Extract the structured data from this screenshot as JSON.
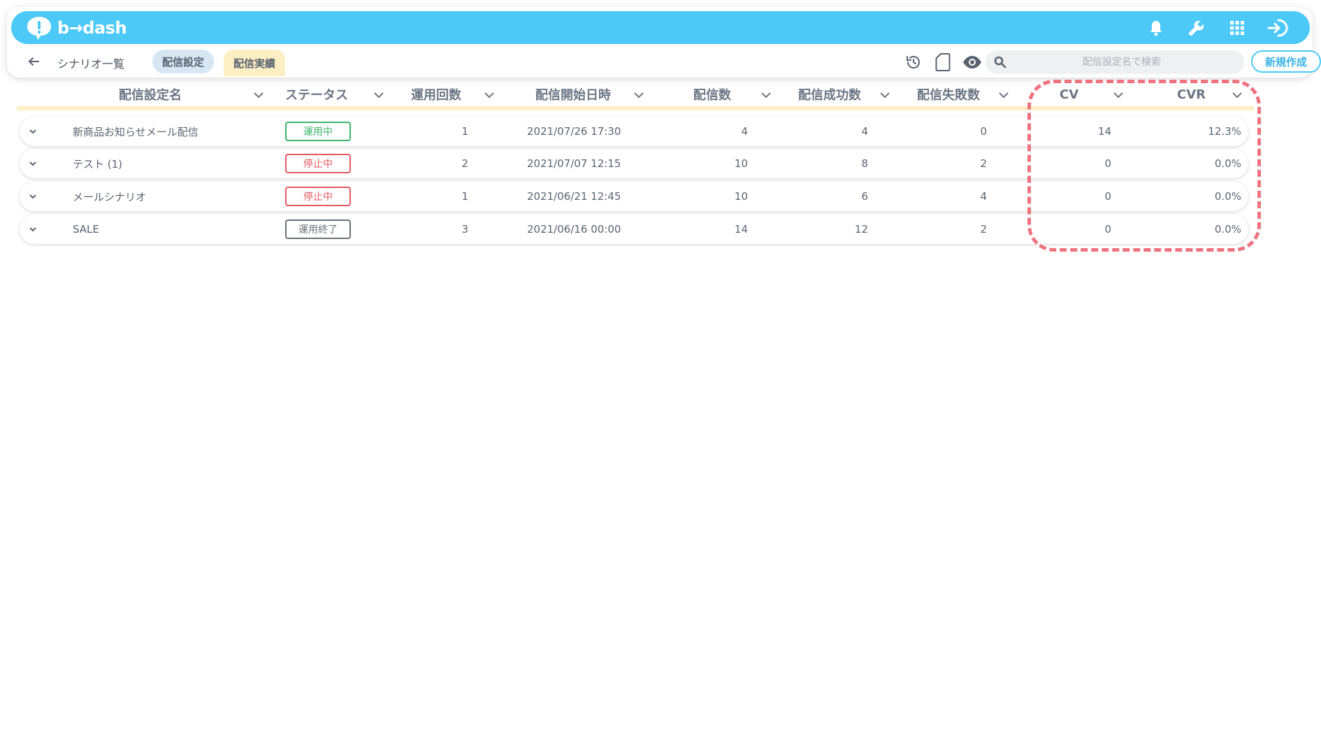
{
  "app": {
    "logo_text": "b→dash"
  },
  "colors": {
    "brand": "#4cc9f7",
    "active_green": "#3bb56b",
    "stopped_red": "#e5585f",
    "ended_gray": "#6a7077",
    "tab_yellow": "#fdefc4",
    "highlight": "#ef7280"
  },
  "topbar": {
    "icons": [
      "bell-icon",
      "wrench-icon",
      "grid-icon",
      "logout-icon"
    ]
  },
  "subnav": {
    "breadcrumb": "シナリオ一覧",
    "tabs": [
      {
        "label": "配信設定"
      },
      {
        "label": "配信実績"
      }
    ],
    "search_placeholder": "配信設定名で検索",
    "new_button": "新規作成"
  },
  "table": {
    "columns": [
      "配信設定名",
      "ステータス",
      "運用回数",
      "配信開始日時",
      "配信数",
      "配信成功数",
      "配信失敗数",
      "CV",
      "CVR"
    ],
    "rows": [
      {
        "name": "新商品お知らせメール配信",
        "status": "運用中",
        "status_kind": "active",
        "runs": "1",
        "start": "2021/07/26 17:30",
        "sent": "4",
        "success": "4",
        "failed": "0",
        "cv": "14",
        "cvr": "12.3%"
      },
      {
        "name": "テスト (1)",
        "status": "停止中",
        "status_kind": "stopped",
        "runs": "2",
        "start": "2021/07/07 12:15",
        "sent": "10",
        "success": "8",
        "failed": "2",
        "cv": "0",
        "cvr": "0.0%"
      },
      {
        "name": "メールシナリオ",
        "status": "停止中",
        "status_kind": "stopped",
        "runs": "1",
        "start": "2021/06/21 12:45",
        "sent": "10",
        "success": "6",
        "failed": "4",
        "cv": "0",
        "cvr": "0.0%"
      },
      {
        "name": "SALE",
        "status": "運用終了",
        "status_kind": "ended",
        "runs": "3",
        "start": "2021/06/16 00:00",
        "sent": "14",
        "success": "12",
        "failed": "2",
        "cv": "0",
        "cvr": "0.0%"
      }
    ]
  }
}
